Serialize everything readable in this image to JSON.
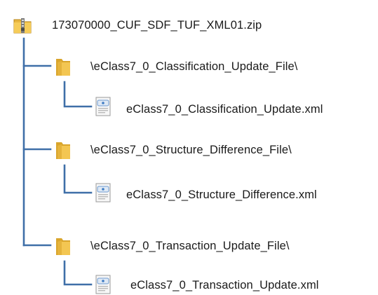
{
  "tree": {
    "root": {
      "label": "173070000_CUF_SDF_TUF_XML01.zip",
      "icon": "zip-folder-icon"
    },
    "folders": [
      {
        "label": "\\eClass7_0_Classification_Update_File\\",
        "icon": "folder-icon",
        "file": {
          "label": "eClass7_0_Classification_Update.xml",
          "icon": "xml-file-icon"
        }
      },
      {
        "label": "\\eClass7_0_Structure_Difference_File\\",
        "icon": "folder-icon",
        "file": {
          "label": "eClass7_0_Structure_Difference.xml",
          "icon": "xml-file-icon"
        }
      },
      {
        "label": "\\eClass7_0_Transaction_Update_File\\",
        "icon": "folder-icon",
        "file": {
          "label": "eClass7_0_Transaction_Update.xml",
          "icon": "xml-file-icon"
        }
      }
    ],
    "line_color": "#3f6fa8"
  }
}
